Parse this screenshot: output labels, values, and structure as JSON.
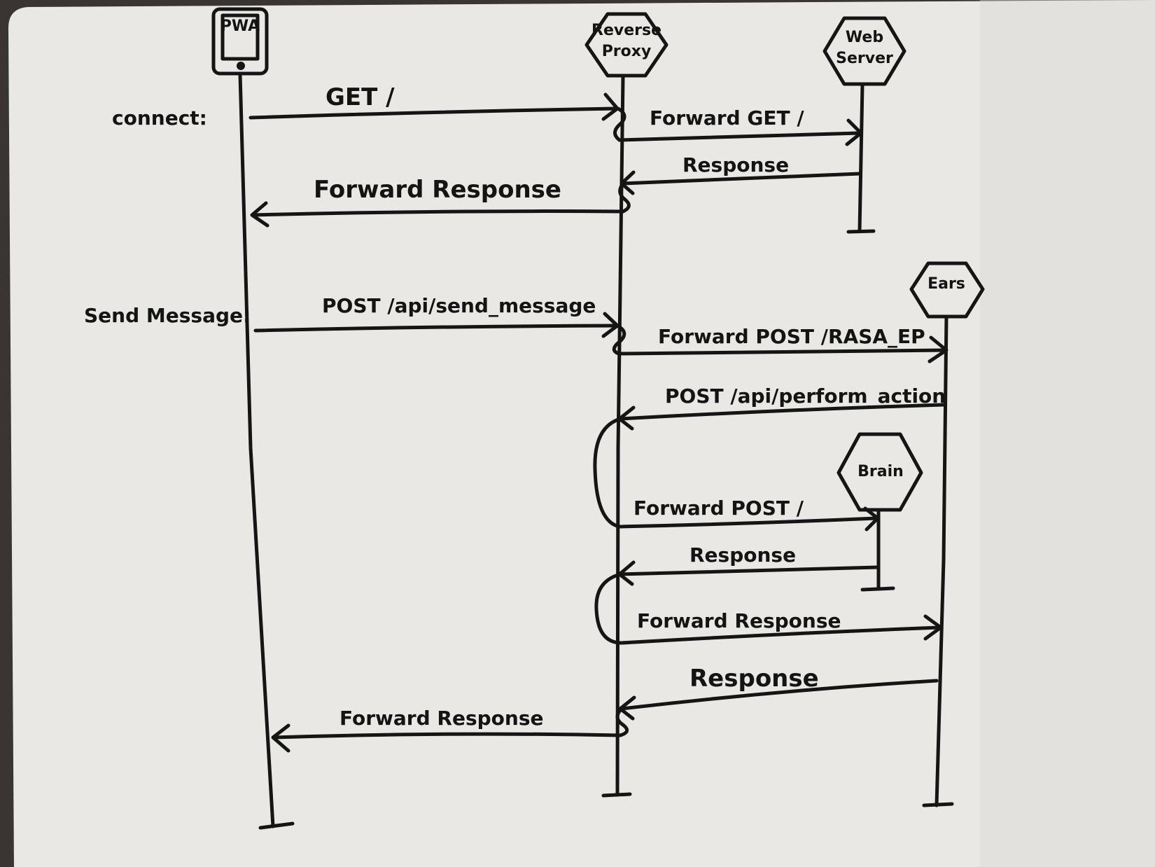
{
  "diagram": {
    "type": "sequence-diagram",
    "colors": {
      "board": "#e9e8e4",
      "ink": "#151515",
      "frame": "#3a3532"
    },
    "actors": [
      {
        "id": "phone",
        "label": "PWA",
        "shape": "phone-icon"
      },
      {
        "id": "proxy",
        "label_line1": "Reverse",
        "label_line2": "Proxy",
        "shape": "hexagon"
      },
      {
        "id": "web",
        "label_line1": "Web",
        "label_line2": "Server",
        "shape": "hexagon"
      },
      {
        "id": "ears",
        "label": "Ears",
        "shape": "hexagon"
      },
      {
        "id": "brain",
        "label": "Brain",
        "shape": "hexagon"
      }
    ],
    "sections": [
      {
        "id": "connect",
        "label": "connect:"
      },
      {
        "id": "send",
        "label": "Send Message:"
      }
    ],
    "messages": [
      {
        "label": "GET /",
        "from": "phone",
        "to": "proxy"
      },
      {
        "label": "Forward GET /",
        "from": "proxy",
        "to": "web"
      },
      {
        "label": "Response",
        "from": "web",
        "to": "proxy"
      },
      {
        "label": "Forward Response",
        "from": "proxy",
        "to": "phone"
      },
      {
        "label": "POST /api/send_message",
        "from": "phone",
        "to": "proxy"
      },
      {
        "label": "Forward POST /RASA_EP",
        "from": "proxy",
        "to": "ears"
      },
      {
        "label": "POST /api/perform_action",
        "from": "ears",
        "to": "proxy"
      },
      {
        "label": "Forward POST /",
        "from": "proxy",
        "to": "brain"
      },
      {
        "label": "Response",
        "from": "brain",
        "to": "proxy"
      },
      {
        "label": "Forward Response",
        "from": "proxy",
        "to": "ears"
      },
      {
        "label": "Response",
        "from": "ears",
        "to": "proxy"
      },
      {
        "label": "Forward Response",
        "from": "proxy",
        "to": "phone"
      }
    ]
  }
}
